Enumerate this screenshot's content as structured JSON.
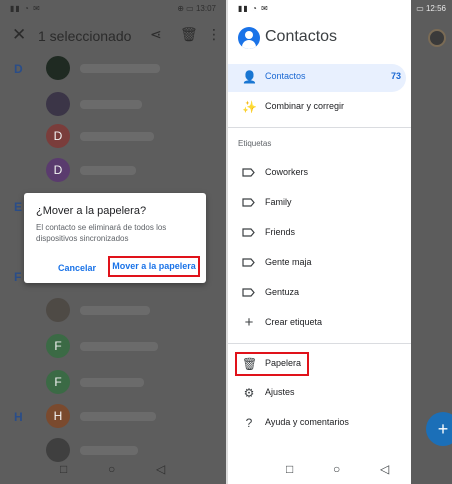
{
  "left": {
    "status_time": "13:07",
    "toolbar": {
      "title": "1 seleccionado"
    },
    "sections": [
      "D",
      "E",
      "F",
      "H"
    ],
    "avatars": [
      "",
      "",
      "D",
      "D",
      "",
      "",
      "F",
      "F",
      "H",
      ""
    ],
    "dialog": {
      "title": "¿Mover a la papelera?",
      "body": "El contacto se eliminará de todos los dispositivos sincronizados",
      "cancel": "Cancelar",
      "confirm": "Mover a la papelera"
    }
  },
  "right": {
    "status_time": "12:56",
    "app_title": "Contactos",
    "menu": {
      "contacts": {
        "label": "Contactos",
        "count": "73"
      },
      "merge": "Combinar y corregir",
      "labels_header": "Etiquetas",
      "labels": [
        "Coworkers",
        "Family",
        "Friends",
        "Gente maja",
        "Gentuza"
      ],
      "create_label": "Crear etiqueta",
      "trash": "Papelera",
      "settings": "Ajustes",
      "help": "Ayuda y comentarios"
    }
  },
  "colors": {
    "accent": "#1a73e8",
    "highlight": "#e0121a",
    "scrim": "#5d5d5d"
  }
}
